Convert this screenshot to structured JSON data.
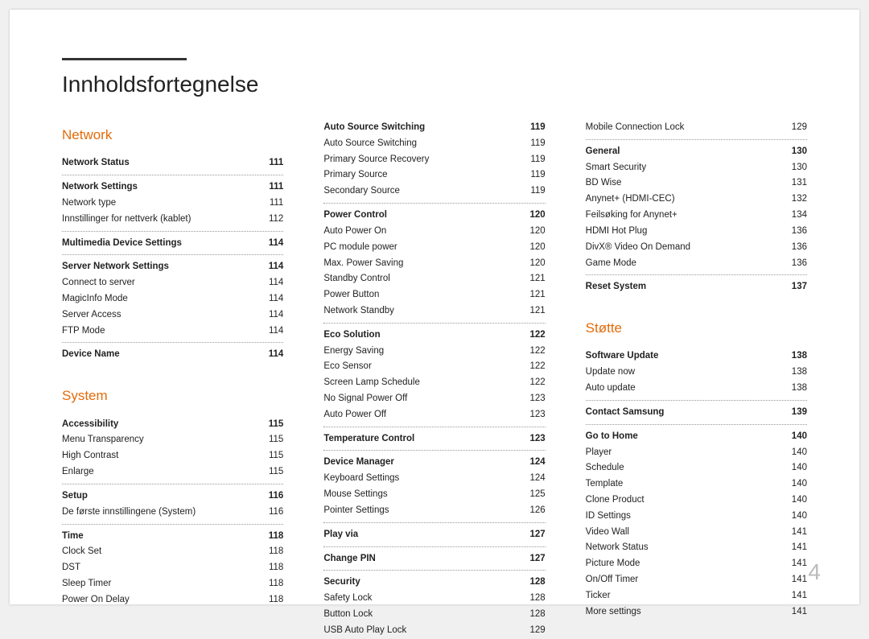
{
  "page_title": "Innholdsfortegnelse",
  "page_number": "4",
  "col1": {
    "section1": {
      "title": "Network"
    },
    "rows1": [
      {
        "label": "Network Status",
        "page": "111",
        "bold": true
      },
      {
        "divider": true
      },
      {
        "label": "Network Settings",
        "page": "111",
        "bold": true
      },
      {
        "label": "Network type",
        "page": "111"
      },
      {
        "label": "Innstillinger for nettverk (kablet)",
        "page": "112"
      },
      {
        "divider": true
      },
      {
        "label": "Multimedia Device Settings",
        "page": "114",
        "bold": true
      },
      {
        "divider": true
      },
      {
        "label": "Server Network Settings",
        "page": "114",
        "bold": true
      },
      {
        "label": "Connect to server",
        "page": "114"
      },
      {
        "label": "MagicInfo Mode",
        "page": "114"
      },
      {
        "label": "Server Access",
        "page": "114"
      },
      {
        "label": "FTP Mode",
        "page": "114"
      },
      {
        "divider": true
      },
      {
        "label": "Device Name",
        "page": "114",
        "bold": true
      }
    ],
    "section2": {
      "title": "System"
    },
    "rows2": [
      {
        "label": "Accessibility",
        "page": "115",
        "bold": true
      },
      {
        "label": "Menu Transparency",
        "page": "115"
      },
      {
        "label": "High Contrast",
        "page": "115"
      },
      {
        "label": "Enlarge",
        "page": "115"
      },
      {
        "divider": true
      },
      {
        "label": "Setup",
        "page": "116",
        "bold": true
      },
      {
        "label": "De første innstillingene (System)",
        "page": "116"
      },
      {
        "divider": true
      },
      {
        "label": "Time",
        "page": "118",
        "bold": true
      },
      {
        "label": "Clock Set",
        "page": "118"
      },
      {
        "label": "DST",
        "page": "118"
      },
      {
        "label": "Sleep Timer",
        "page": "118"
      },
      {
        "label": "Power On Delay",
        "page": "118"
      }
    ]
  },
  "col2": {
    "rows": [
      {
        "label": "Auto Source Switching",
        "page": "119",
        "bold": true
      },
      {
        "label": "Auto Source Switching",
        "page": "119"
      },
      {
        "label": "Primary Source Recovery",
        "page": "119"
      },
      {
        "label": "Primary Source",
        "page": "119"
      },
      {
        "label": "Secondary Source",
        "page": "119"
      },
      {
        "divider": true
      },
      {
        "label": "Power Control",
        "page": "120",
        "bold": true
      },
      {
        "label": "Auto Power On",
        "page": "120"
      },
      {
        "label": "PC module power",
        "page": "120"
      },
      {
        "label": "Max. Power Saving",
        "page": "120"
      },
      {
        "label": "Standby Control",
        "page": "121"
      },
      {
        "label": "Power Button",
        "page": "121"
      },
      {
        "label": "Network Standby",
        "page": "121"
      },
      {
        "divider": true
      },
      {
        "label": "Eco Solution",
        "page": "122",
        "bold": true
      },
      {
        "label": "Energy Saving",
        "page": "122"
      },
      {
        "label": "Eco Sensor",
        "page": "122"
      },
      {
        "label": "Screen Lamp Schedule",
        "page": "122"
      },
      {
        "label": "No Signal Power Off",
        "page": "123"
      },
      {
        "label": "Auto Power Off",
        "page": "123"
      },
      {
        "divider": true
      },
      {
        "label": "Temperature Control",
        "page": "123",
        "bold": true
      },
      {
        "divider": true
      },
      {
        "label": "Device Manager",
        "page": "124",
        "bold": true
      },
      {
        "label": "Keyboard Settings",
        "page": "124"
      },
      {
        "label": "Mouse Settings",
        "page": "125"
      },
      {
        "label": "Pointer Settings",
        "page": "126"
      },
      {
        "divider": true
      },
      {
        "label": "Play via",
        "page": "127",
        "bold": true
      },
      {
        "divider": true
      },
      {
        "label": "Change PIN",
        "page": "127",
        "bold": true
      },
      {
        "divider": true
      },
      {
        "label": "Security",
        "page": "128",
        "bold": true
      },
      {
        "label": "Safety Lock",
        "page": "128"
      },
      {
        "label": "Button Lock",
        "page": "128"
      },
      {
        "label": "USB Auto Play Lock",
        "page": "129"
      }
    ]
  },
  "col3": {
    "rows1": [
      {
        "label": "Mobile Connection Lock",
        "page": "129"
      },
      {
        "divider": true
      },
      {
        "label": "General",
        "page": "130",
        "bold": true
      },
      {
        "label": "Smart Security",
        "page": "130"
      },
      {
        "label": "BD Wise",
        "page": "131"
      },
      {
        "label": "Anynet+ (HDMI-CEC)",
        "page": "132"
      },
      {
        "label": "Feilsøking for Anynet+",
        "page": "134"
      },
      {
        "label": "HDMI Hot Plug",
        "page": "136"
      },
      {
        "label": "DivX® Video On Demand",
        "page": "136"
      },
      {
        "label": "Game Mode",
        "page": "136"
      },
      {
        "divider": true
      },
      {
        "label": "Reset System",
        "page": "137",
        "bold": true
      }
    ],
    "section2": {
      "title": "Støtte"
    },
    "rows2": [
      {
        "label": "Software Update",
        "page": "138",
        "bold": true
      },
      {
        "label": "Update now",
        "page": "138"
      },
      {
        "label": "Auto update",
        "page": "138"
      },
      {
        "divider": true
      },
      {
        "label": "Contact Samsung",
        "page": "139",
        "bold": true
      },
      {
        "divider": true
      },
      {
        "label": "Go to Home",
        "page": "140",
        "bold": true
      },
      {
        "label": "Player",
        "page": "140"
      },
      {
        "label": "Schedule",
        "page": "140"
      },
      {
        "label": "Template",
        "page": "140"
      },
      {
        "label": "Clone Product",
        "page": "140"
      },
      {
        "label": "ID Settings",
        "page": "140"
      },
      {
        "label": "Video Wall",
        "page": "141"
      },
      {
        "label": "Network Status",
        "page": "141"
      },
      {
        "label": "Picture Mode",
        "page": "141"
      },
      {
        "label": "On/Off Timer",
        "page": "141"
      },
      {
        "label": "Ticker",
        "page": "141"
      },
      {
        "label": "More settings",
        "page": "141"
      }
    ]
  }
}
